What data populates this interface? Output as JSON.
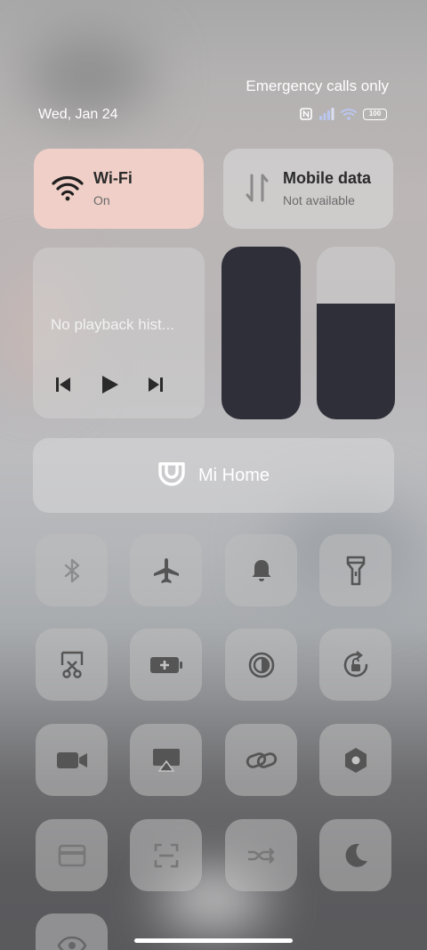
{
  "status_bar": {
    "carrier_text": "Emergency calls only",
    "date": "Wed, Jan 24",
    "battery": "100",
    "icons": [
      "nfc-icon",
      "signal-icon",
      "wifi-icon",
      "battery-icon"
    ]
  },
  "wifi_tile": {
    "title": "Wi-Fi",
    "subtitle": "On",
    "accent": "#efcfc7"
  },
  "mobile_tile": {
    "title": "Mobile data",
    "subtitle": "Not available"
  },
  "media": {
    "text": "No playback hist..."
  },
  "brightness": {
    "level": 1.0
  },
  "volume": {
    "level": 0.67
  },
  "mi_home": {
    "label": "Mi Home"
  },
  "toggles": [
    "bluetooth-icon",
    "airplane-icon",
    "bell-icon",
    "flashlight-icon",
    "screenshot-icon",
    "battery-saver-icon",
    "reading-mode-icon",
    "rotation-lock-icon",
    "video-camera-icon",
    "cast-icon",
    "link-icon",
    "settings-hex-icon",
    "card-icon",
    "scan-icon",
    "swap-icon",
    "moon-icon",
    "eye-icon"
  ]
}
